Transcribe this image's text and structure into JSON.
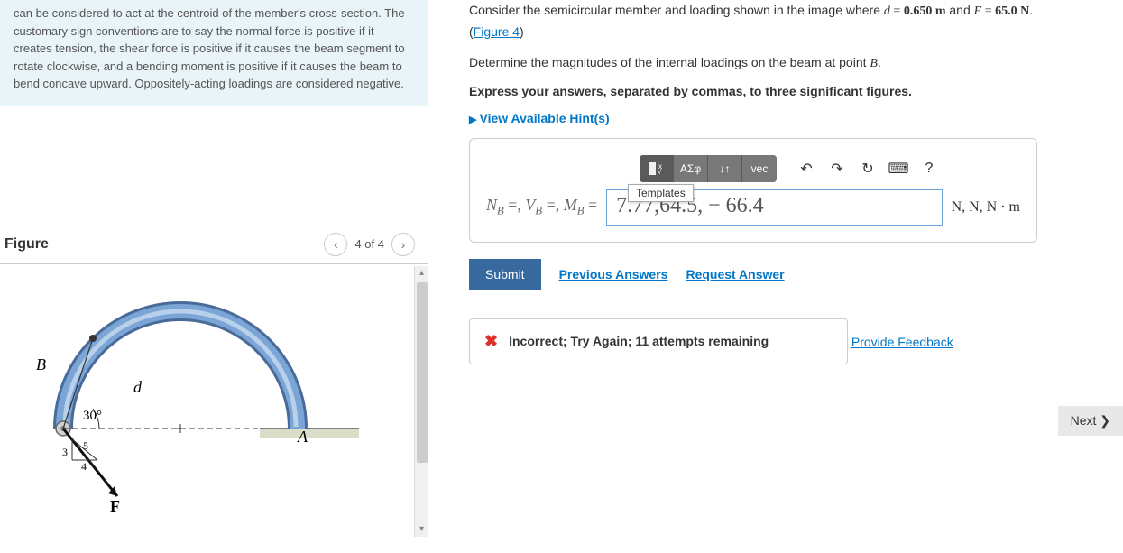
{
  "info": {
    "text": "can be considered to act at the centroid of the member's cross-section. The customary sign conventions are to say the normal force is positive if it creates tension, the shear force is positive if it causes the beam segment to rotate clockwise, and a bending moment is positive if it causes the beam to bend concave upward. Oppositely-acting loadings are considered negative."
  },
  "figure": {
    "title": "Figure",
    "counter": "4 of 4",
    "labels": {
      "B": "B",
      "A": "A",
      "d": "d",
      "angle": "30°",
      "F": "F",
      "tri_h": "3",
      "tri_v": "5",
      "tri_b": "4"
    }
  },
  "problem": {
    "intro_pre": "Consider the semicircular member and loading shown in the image where ",
    "var_d": "d",
    "eq": " = ",
    "val_d": "0.650 m",
    "and": " and ",
    "var_F": "F",
    "val_F": "65.0 N",
    "period": ".",
    "figlink": "Figure 4",
    "instruction": "Determine the magnitudes of the internal loadings on the beam at point ",
    "point": "B",
    "bold": "Express your answers, separated by commas, to three significant figures.",
    "hints": "View Available Hint(s)"
  },
  "toolbar": {
    "templates_tooltip": "Templates",
    "sqrt": "√",
    "greek": "ΑΣφ",
    "arrows": "↓↑",
    "vec": "vec",
    "undo": "↶",
    "redo": "↷",
    "reset": "↻",
    "keyboard": "⌨",
    "help": "?"
  },
  "answer": {
    "label_html": "N<sub>B</sub> =, V<sub>B</sub> =, M<sub>B</sub> = ",
    "value": "7.77,64.5, − 66.4",
    "units": "N, N, N · m"
  },
  "actions": {
    "submit": "Submit",
    "previous": "Previous Answers",
    "request": "Request Answer"
  },
  "feedback": {
    "message": "Incorrect; Try Again; 11 attempts remaining"
  },
  "footer": {
    "provide": "Provide Feedback",
    "next": "Next ❯"
  }
}
